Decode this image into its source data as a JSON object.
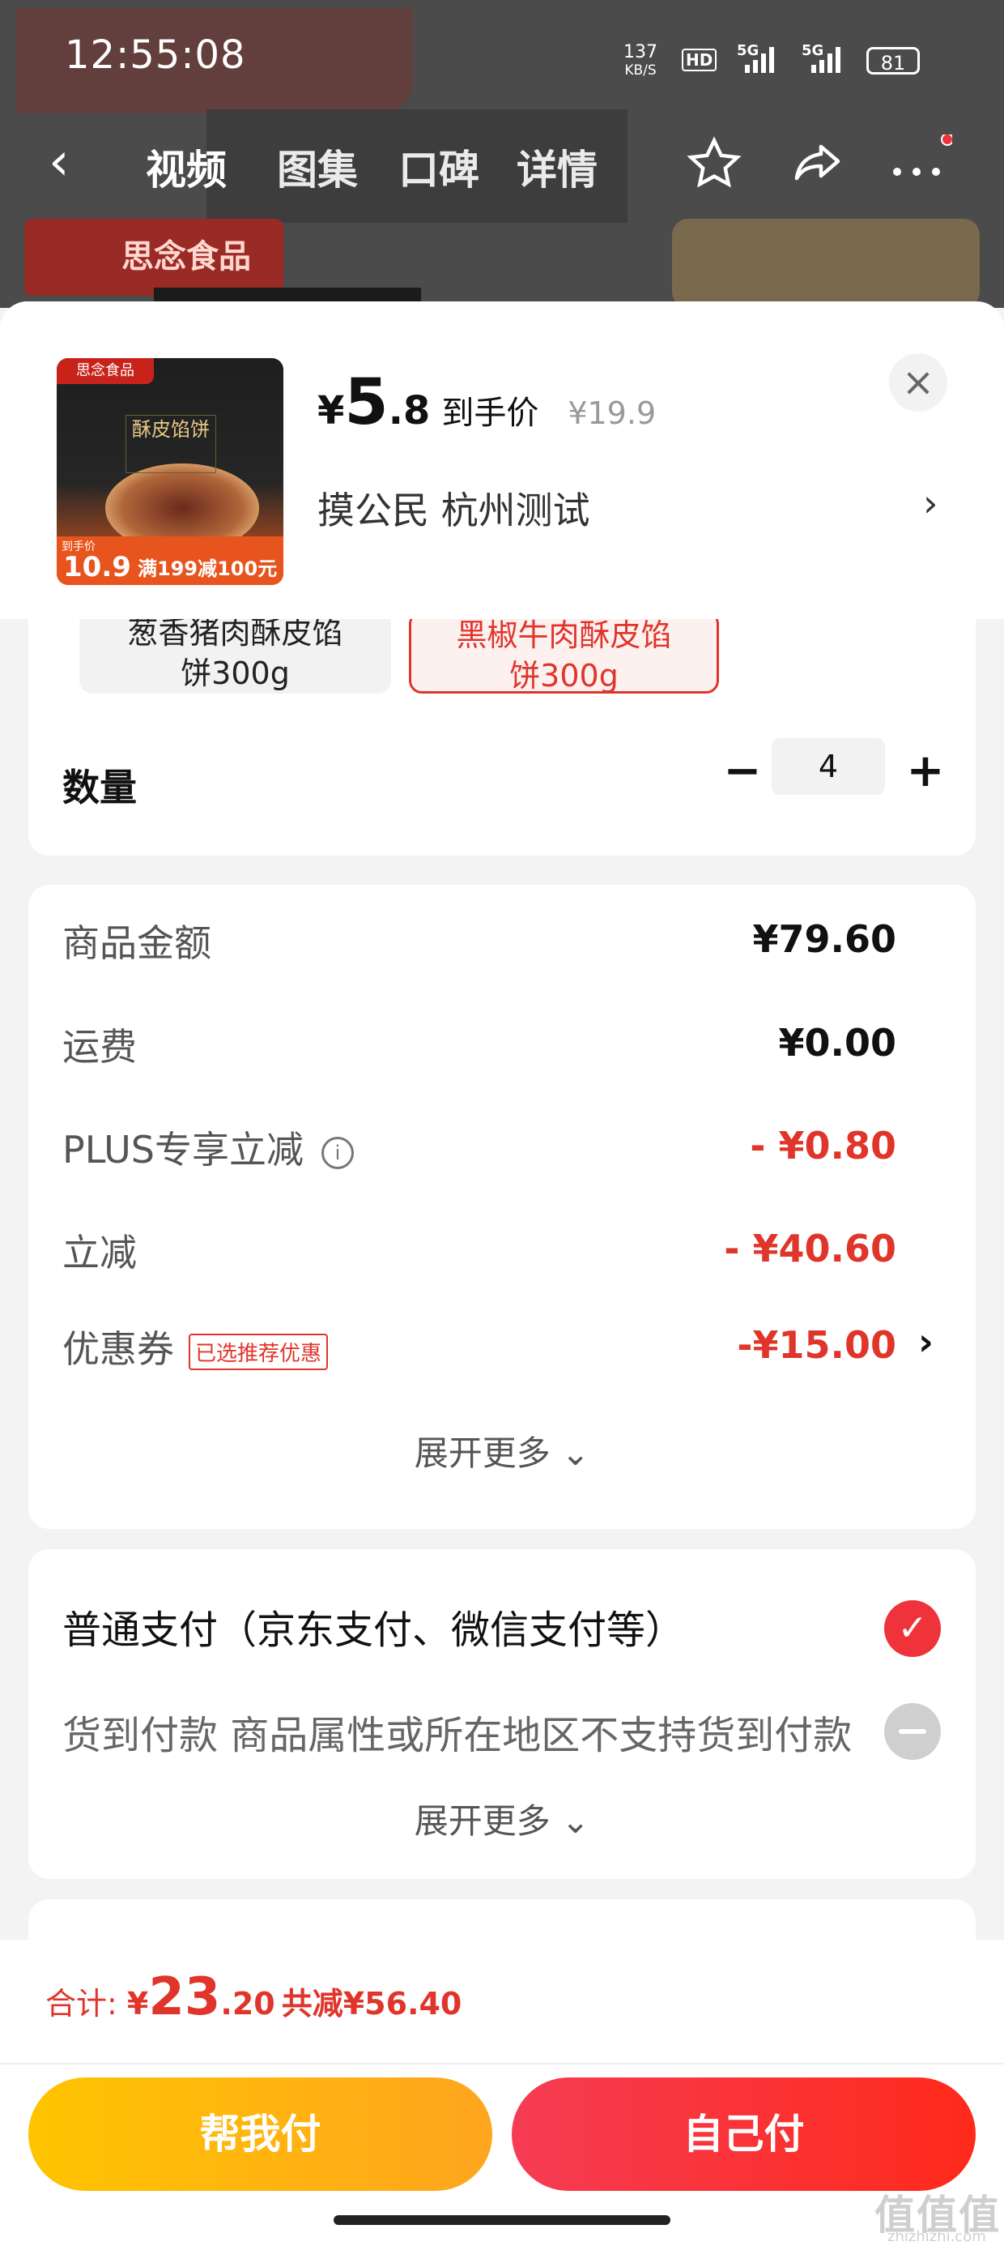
{
  "status_bar": {
    "time": "12:55:08",
    "net_speed": "137",
    "net_unit": "KB/S",
    "hd": "HD",
    "signal1": "5G",
    "signal2": "5G",
    "battery": "81"
  },
  "nav": {
    "tabs": [
      "视频",
      "图集",
      "口碑",
      "详情"
    ],
    "active_tab": "视频"
  },
  "background": {
    "brand": "思念食品"
  },
  "product": {
    "thumb_brand": "思念食品",
    "thumb_title": "酥皮馅饼",
    "thumb_price_label": "到手价",
    "thumb_price": "10.9",
    "thumb_promo": "满199减100元",
    "price_currency": "¥",
    "price_int": "5",
    "price_dec": ".8",
    "price_label": "到手价",
    "original_price": "¥19.9",
    "spec": "摸公民  杭州测试",
    "close_symbol": "×"
  },
  "variants": [
    {
      "label_line1": "葱香猪肉酥皮馅",
      "label_line2": "饼300g",
      "selected": false
    },
    {
      "label_line1": "黑椒牛肉酥皮馅",
      "label_line2": "饼300g",
      "selected": true
    }
  ],
  "quantity": {
    "label": "数量",
    "value": "4"
  },
  "costs": {
    "rows": [
      {
        "label": "商品金额",
        "value": "¥79.60",
        "red": false
      },
      {
        "label": "运费",
        "value": "¥0.00",
        "red": false
      },
      {
        "label": "PLUS专享立减",
        "value": "- ¥0.80",
        "red": true
      },
      {
        "label": "立减",
        "value": "- ¥40.60",
        "red": true
      }
    ],
    "coupon_label": "优惠券",
    "coupon_tag": "已选推荐优惠",
    "coupon_value": "-¥15.00",
    "expand": "展开更多"
  },
  "payment": {
    "options": [
      {
        "label": "普通支付（京东支付、微信支付等）",
        "selected": true
      },
      {
        "label": "货到付款 商品属性或所在地区不支持货到付款",
        "selected": false,
        "disabled": true
      }
    ],
    "expand": "展开更多"
  },
  "footer": {
    "total_label": "合计: ",
    "total_currency": "¥",
    "total_int": "23",
    "total_dec": ".20",
    "savings": "共减¥56.40",
    "help_pay": "帮我付",
    "self_pay": "自己付"
  },
  "watermark": {
    "line1": "值值值",
    "line2": "zhizhizhi.com"
  },
  "colors": {
    "accent_red": "#e0352b",
    "help_btn": "#ffb400",
    "self_btn": "#f5333f"
  }
}
